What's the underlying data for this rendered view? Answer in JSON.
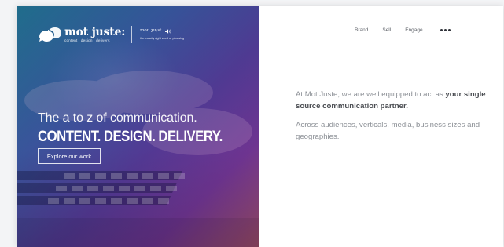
{
  "logo": {
    "name": "mot juste:",
    "tagline": "content . design . delivery.",
    "pronunciation": "moʊ ʒuːst",
    "meaning": "the exactly right word or phrasing"
  },
  "nav": {
    "items": [
      {
        "label": "Brand"
      },
      {
        "label": "Sell"
      },
      {
        "label": "Engage"
      }
    ],
    "more_icon": "more-dots-icon"
  },
  "hero": {
    "line1": "The a to z of communication.",
    "line2": "CONTENT. DESIGN. DELIVERY.",
    "cta_label": "Explore our work"
  },
  "copy": {
    "p1_pre": "At Mot Juste, we are well equipped to act as ",
    "p1_bold": "your single source communication partner.",
    "p2": "Across audiences, verticals, media, business sizes and geographies."
  },
  "colors": {
    "text_muted": "#8c9096",
    "text_dark": "#4a4d52",
    "hero_teal": "#227e98",
    "hero_purple": "#7a3a9c"
  }
}
